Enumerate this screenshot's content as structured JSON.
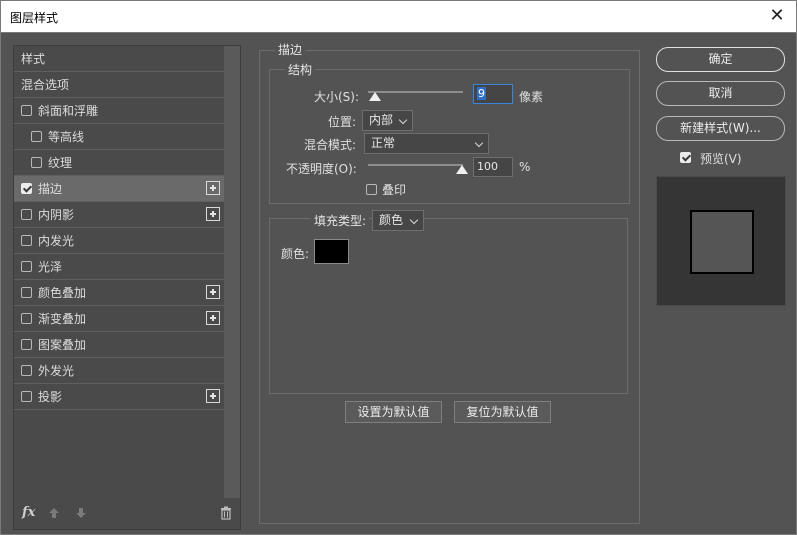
{
  "window": {
    "title": "图层样式"
  },
  "left_panel": {
    "items": [
      {
        "label": "样式",
        "checkbox": false,
        "checked": false,
        "plus": false,
        "indent": false,
        "selected": false
      },
      {
        "label": "混合选项",
        "checkbox": false,
        "checked": false,
        "plus": false,
        "indent": false,
        "selected": false
      },
      {
        "label": "斜面和浮雕",
        "checkbox": true,
        "checked": false,
        "plus": false,
        "indent": false,
        "selected": false
      },
      {
        "label": "等高线",
        "checkbox": true,
        "checked": false,
        "plus": false,
        "indent": true,
        "selected": false
      },
      {
        "label": "纹理",
        "checkbox": true,
        "checked": false,
        "plus": false,
        "indent": true,
        "selected": false
      },
      {
        "label": "描边",
        "checkbox": true,
        "checked": true,
        "plus": true,
        "indent": false,
        "selected": true
      },
      {
        "label": "内阴影",
        "checkbox": true,
        "checked": false,
        "plus": true,
        "indent": false,
        "selected": false
      },
      {
        "label": "内发光",
        "checkbox": true,
        "checked": false,
        "plus": false,
        "indent": false,
        "selected": false
      },
      {
        "label": "光泽",
        "checkbox": true,
        "checked": false,
        "plus": false,
        "indent": false,
        "selected": false
      },
      {
        "label": "颜色叠加",
        "checkbox": true,
        "checked": false,
        "plus": true,
        "indent": false,
        "selected": false
      },
      {
        "label": "渐变叠加",
        "checkbox": true,
        "checked": false,
        "plus": true,
        "indent": false,
        "selected": false
      },
      {
        "label": "图案叠加",
        "checkbox": true,
        "checked": false,
        "plus": false,
        "indent": false,
        "selected": false
      },
      {
        "label": "外发光",
        "checkbox": true,
        "checked": false,
        "plus": false,
        "indent": false,
        "selected": false
      },
      {
        "label": "投影",
        "checkbox": true,
        "checked": false,
        "plus": true,
        "indent": false,
        "selected": false
      }
    ],
    "footer": {
      "fx_label": "fx"
    }
  },
  "stroke": {
    "section_title": "描边",
    "structure_title": "结构",
    "size_label": "大小(S):",
    "size_value": "9",
    "size_unit": "像素",
    "position_label": "位置:",
    "position_value": "内部",
    "blend_label": "混合模式:",
    "blend_value": "正常",
    "opacity_label": "不透明度(O):",
    "opacity_value": "100",
    "opacity_unit": "%",
    "overprint_label": "叠印",
    "overprint_checked": false,
    "fill_type_label": "填充类型:",
    "fill_type_value": "颜色",
    "color_label": "颜色:",
    "color_value": "#000000",
    "set_default_label": "设置为默认值",
    "reset_default_label": "复位为默认值"
  },
  "actions": {
    "ok_label": "确定",
    "cancel_label": "取消",
    "new_style_label": "新建样式(W)...",
    "preview_label": "预览(V)",
    "preview_checked": true
  },
  "colors": {
    "dialog_bg": "#535353",
    "focus_blue": "#3b84dc"
  }
}
